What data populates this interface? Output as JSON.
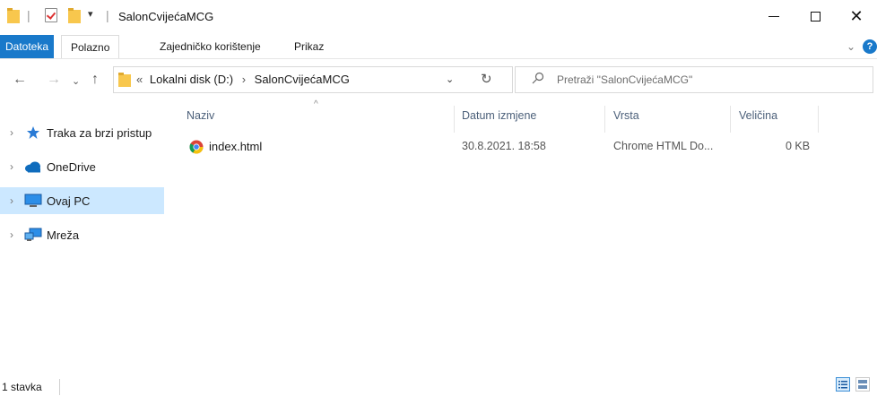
{
  "window": {
    "title": "SalonCvijećaMCG"
  },
  "ribbon": {
    "tabs": [
      {
        "label": "Datoteka"
      },
      {
        "label": "Polazno"
      },
      {
        "label": "Zajedničko korištenje"
      },
      {
        "label": "Prikaz"
      }
    ],
    "help": "?"
  },
  "address": {
    "overflow": "«",
    "path": [
      "Lokalni disk (D:)",
      "SalonCvijećaMCG"
    ],
    "separator": "›"
  },
  "search": {
    "placeholder": "Pretraži \"SalonCvijećaMCG\""
  },
  "nav": {
    "items": [
      {
        "label": "Traka za brzi pristup",
        "icon": "star-icon"
      },
      {
        "label": "OneDrive",
        "icon": "cloud-icon"
      },
      {
        "label": "Ovaj PC",
        "icon": "monitor-icon"
      },
      {
        "label": "Mreža",
        "icon": "network-icon"
      }
    ]
  },
  "columns": {
    "name": "Naziv",
    "date": "Datum izmjene",
    "type": "Vrsta",
    "size": "Veličina"
  },
  "files": [
    {
      "name": "index.html",
      "date": "30.8.2021. 18:58",
      "type": "Chrome HTML Do...",
      "size": "0 KB",
      "icon": "chrome-icon"
    }
  ],
  "status": {
    "text": "1 stavka"
  },
  "colors": {
    "accent": "#1979ca",
    "selected": "#cce8ff",
    "folder": "#f8c74d"
  }
}
